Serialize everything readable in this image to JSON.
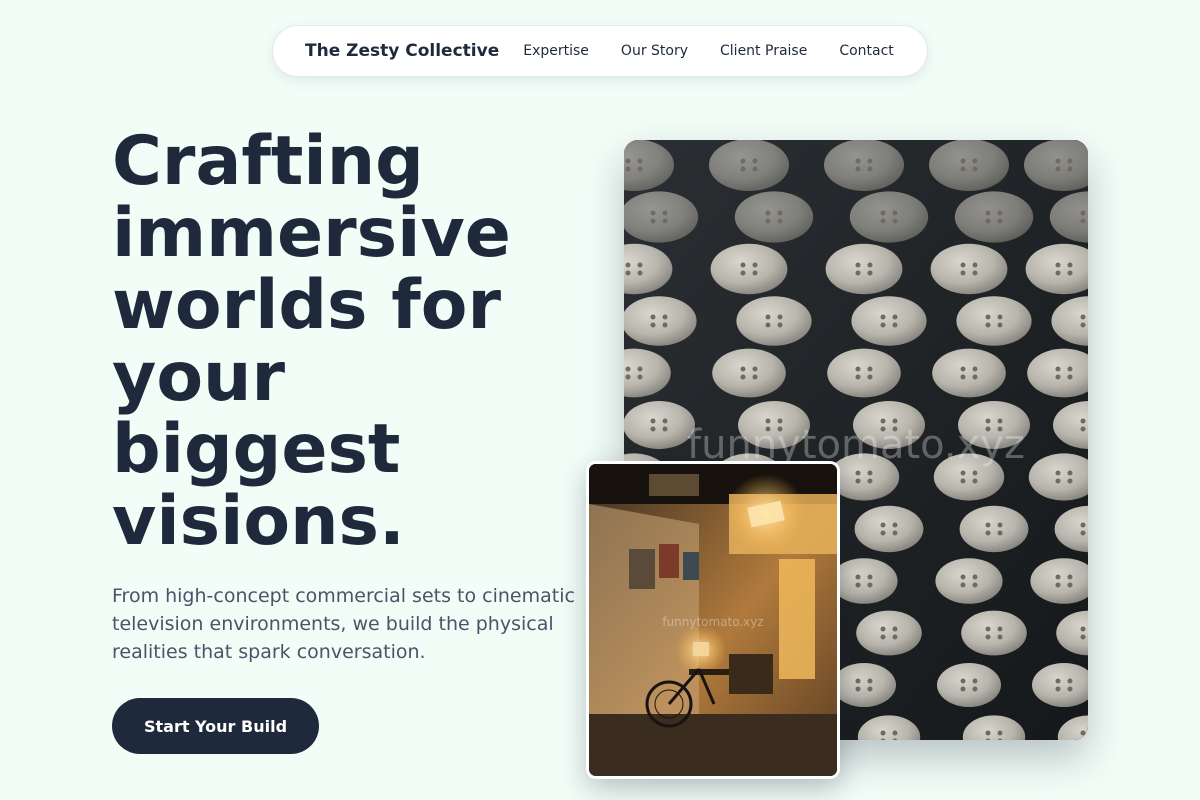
{
  "nav": {
    "brand": "The Zesty Collective",
    "links": [
      "Expertise",
      "Our Story",
      "Client Praise",
      "Contact"
    ]
  },
  "hero": {
    "title": "Crafting immersive worlds for your biggest visions.",
    "description": "From high-concept commercial sets to cinematic television environments, we build the physical realities that spark conversation.",
    "cta_label": "Start Your Build"
  },
  "images": {
    "main": {
      "subject": "rows of round buttons on dark fabric",
      "watermark": "funnytomato.xyz"
    },
    "inset": {
      "subject": "film set interior with bicycle, lamp and studio light",
      "watermark": "funnytomato.xyz"
    }
  },
  "colors": {
    "background": "#f2fdf8",
    "primary": "#1e293b",
    "body_text": "#475569",
    "nav_bg": "#ffffff"
  }
}
